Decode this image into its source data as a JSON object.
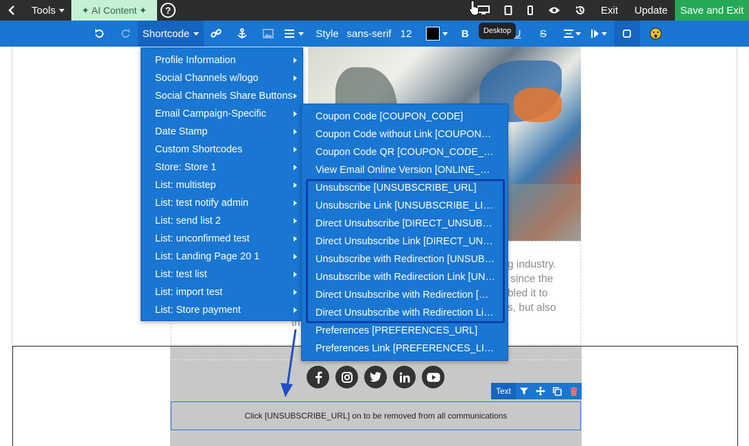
{
  "topbar": {
    "tools_label": "Tools",
    "ai_label": "AI Content",
    "help_glyph": "?",
    "exit_label": "Exit",
    "update_label": "Update",
    "save_exit_label": "Save and Exit"
  },
  "toolbar": {
    "shortcode_label": "Shortcode",
    "style_label": "Style",
    "font_family": "sans-serif",
    "font_size": "12",
    "bold_label": "B",
    "underline_label": "U",
    "strike_label": "S",
    "tooltip": "Desktop"
  },
  "menu_shortcode": {
    "items": [
      "Profile Information",
      "Social Channels w/logo",
      "Social Channels Share Buttons",
      "Email Campaign-Specific",
      "Date Stamp",
      "Custom Shortcodes",
      "Store: Store 1",
      "List: multistep",
      "List: test notify admin",
      "List: send list 2",
      "List: unconfirmed test",
      "List: Landing Page 20 1",
      "List: test list",
      "List: import test",
      "List: Store payment"
    ]
  },
  "menu_email": {
    "items": [
      "Coupon Code [COUPON_CODE]",
      "Coupon Code without Link [COUPON_CODE_NO_LINK]",
      "Coupon Code QR [COUPON_CODE_QR]",
      "View Email Online Version [ONLINE_URL]",
      "Unsubscribe [UNSUBSCRIBE_URL]",
      "Unsubscribe Link [UNSUBSCRIBE_LINK]",
      "Direct Unsubscribe [DIRECT_UNSUBSCRIBE_URL]",
      "Direct Unsubscribe Link [DIRECT_UNSUBSCRIBE_LINK]",
      "Unsubscribe with Redirection [UNSUBSCRIBE_REDIRECT_URL]",
      "Unsubscribe with Redirection Link [UNSUBSCRIBE_REDIRECT_LINK]",
      "Direct Unsubscribe with Redirection [DIRECT_UNSUBSCRIBE_REDIRECT_URL]",
      "Direct Unsubscribe with Redirection Link [DIRECT_UNSUBSCRIBE_REDIRECT_LINK]",
      "Preferences [PREFERENCES_URL]",
      "Preferences Link [PREFERENCES_LINK]"
    ]
  },
  "content": {
    "body_text": "g industry.\n since the\nbled it to\ns, but also",
    "body_fragment": "th",
    "unsubscribe_text": "Click [UNSUBSCRIBE_URL] on to be removed from all communications",
    "text_bar_label": "Text"
  },
  "colors": {
    "toolbar_blue": "#1976d2",
    "topbar_dark": "#2d2d2d",
    "ai_green": "#c6f0d4",
    "save_green": "#25a956",
    "highlight": "#0d3fa6"
  }
}
